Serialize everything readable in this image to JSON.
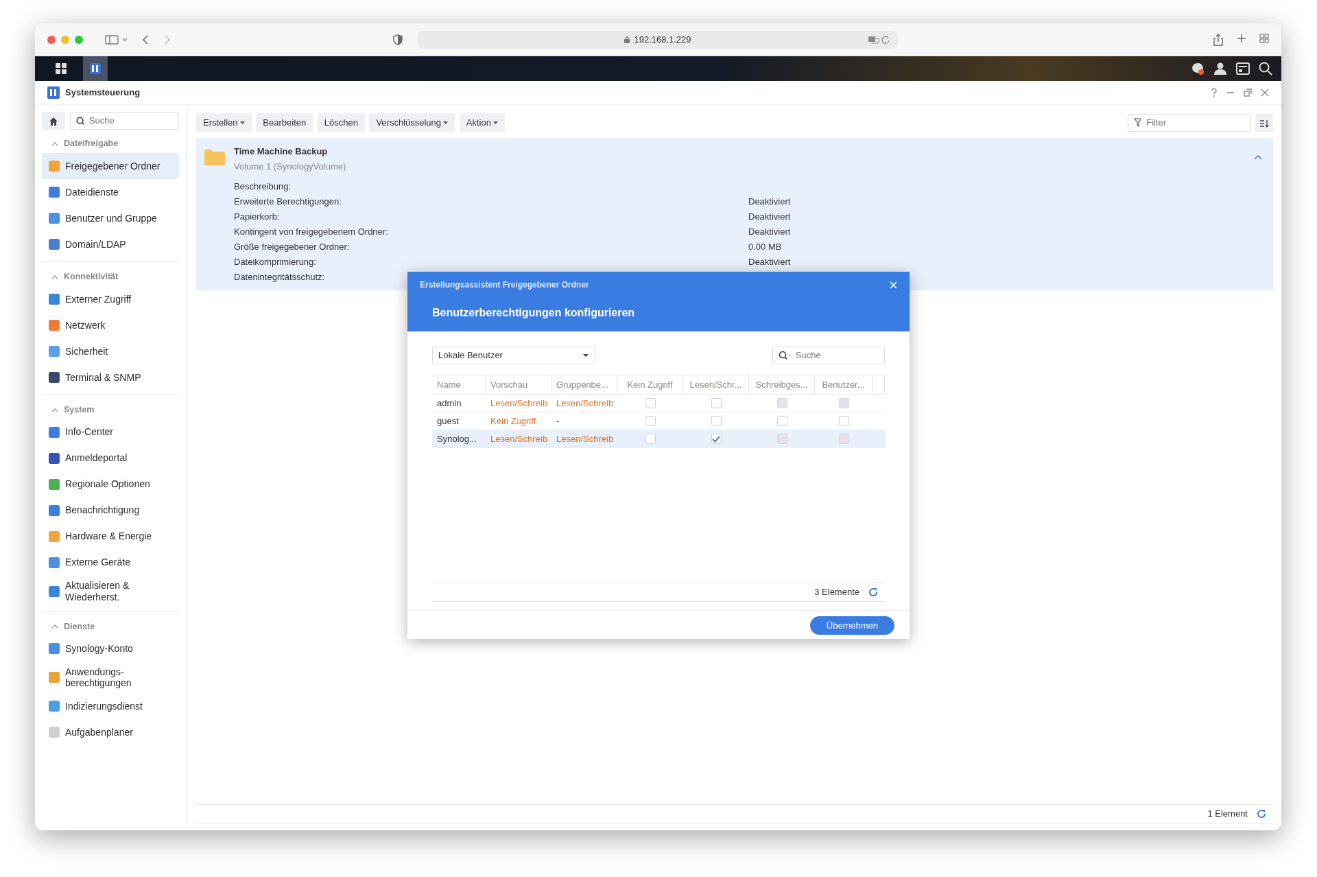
{
  "browser": {
    "address": "192.168.1.229"
  },
  "window": {
    "title": "Systemsteuerung"
  },
  "sidebar": {
    "search": {
      "placeholder": "Suche"
    },
    "sections": [
      {
        "title": "Dateifreigabe",
        "expanded": true,
        "items": [
          {
            "label": "Freigegebener Ordner",
            "selected": true
          },
          {
            "label": "Dateidienste",
            "selected": false
          },
          {
            "label": "Benutzer und Gruppe",
            "selected": false
          },
          {
            "label": "Domain/LDAP",
            "selected": false
          }
        ]
      },
      {
        "title": "Konnektivität",
        "expanded": true,
        "items": [
          {
            "label": "Externer Zugriff",
            "selected": false
          },
          {
            "label": "Netzwerk",
            "selected": false
          },
          {
            "label": "Sicherheit",
            "selected": false
          },
          {
            "label": "Terminal & SNMP",
            "selected": false
          }
        ]
      },
      {
        "title": "System",
        "expanded": true,
        "items": [
          {
            "label": "Info-Center",
            "selected": false
          },
          {
            "label": "Anmeldeportal",
            "selected": false
          },
          {
            "label": "Regionale Optionen",
            "selected": false
          },
          {
            "label": "Benachrichtigung",
            "selected": false
          },
          {
            "label": "Hardware & Energie",
            "selected": false
          },
          {
            "label": "Externe Geräte",
            "selected": false
          },
          {
            "label": "Aktualisieren & Wiederherst.",
            "selected": false
          }
        ]
      },
      {
        "title": "Dienste",
        "expanded": true,
        "items": [
          {
            "label": "Synology-Konto",
            "selected": false
          },
          {
            "label": "Anwendungs-berechtigungen",
            "selected": false
          },
          {
            "label": "Indizierungsdienst",
            "selected": false
          },
          {
            "label": "Aufgabenplaner",
            "selected": false
          }
        ]
      }
    ]
  },
  "toolbar": {
    "buttons": [
      {
        "label": "Erstellen",
        "dropdown": true
      },
      {
        "label": "Bearbeiten",
        "dropdown": false
      },
      {
        "label": "Löschen",
        "dropdown": false
      },
      {
        "label": "Verschlüsselung",
        "dropdown": true
      },
      {
        "label": "Aktion",
        "dropdown": true
      }
    ],
    "filter": {
      "placeholder": "Filter"
    }
  },
  "folder": {
    "name": "Time Machine Backup",
    "volume": "Volume 1 (SynologyVolume)",
    "expanded": true,
    "properties": [
      {
        "label": "Beschreibung:"
      },
      {
        "label": "Erweiterte Berechtigungen:",
        "value": "Deaktiviert"
      },
      {
        "label": "Papierkorb:",
        "value": "Deaktiviert"
      },
      {
        "label": "Kontingent von freigegebenem Ordner:",
        "value": "Deaktiviert"
      },
      {
        "label": "Größe freigegebener Ordner:",
        "value": "0.00 MB"
      },
      {
        "label": "Dateikomprimierung:",
        "value": "Deaktiviert"
      },
      {
        "label": "Datenintegritätsschutz:"
      }
    ]
  },
  "status_bar": {
    "count": "1 Element"
  },
  "dialog": {
    "title": "Erstellungsassistent Freigegebener Ordner",
    "heading": "Benutzerberechtigungen konfigurieren",
    "user_type": "Lokale Benutzer",
    "search": {
      "placeholder": "Suche"
    },
    "columns": [
      "Name",
      "Vorschau",
      "Gruppenbe...",
      "Kein Zugriff",
      "Lesen/Schr...",
      "Schreibges...",
      "Benutzer..."
    ],
    "rows": [
      {
        "name": "admin",
        "preview": "Lesen/Schreib",
        "group": "Lesen/Schreib",
        "selected": false,
        "permissions": [
          {
            "checked": false,
            "disabled": false
          },
          {
            "checked": false,
            "disabled": false
          },
          {
            "checked": false,
            "disabled": true
          },
          {
            "checked": false,
            "disabled": true
          }
        ]
      },
      {
        "name": "guest",
        "preview": "Kein Zugriff",
        "group": "-",
        "selected": false,
        "permissions": [
          {
            "checked": false,
            "disabled": false
          },
          {
            "checked": false,
            "disabled": false
          },
          {
            "checked": false,
            "disabled": false
          },
          {
            "checked": false,
            "disabled": false
          }
        ]
      },
      {
        "name": "Synolog...",
        "preview": "Lesen/Schreib",
        "group": "Lesen/Schreib",
        "selected": true,
        "permissions": [
          {
            "checked": false,
            "disabled": false
          },
          {
            "checked": true,
            "disabled": false
          },
          {
            "checked": false,
            "disabled": true
          },
          {
            "checked": false,
            "disabled": true
          }
        ]
      }
    ],
    "count": "3 Elemente",
    "apply_button": "Übernehmen"
  }
}
